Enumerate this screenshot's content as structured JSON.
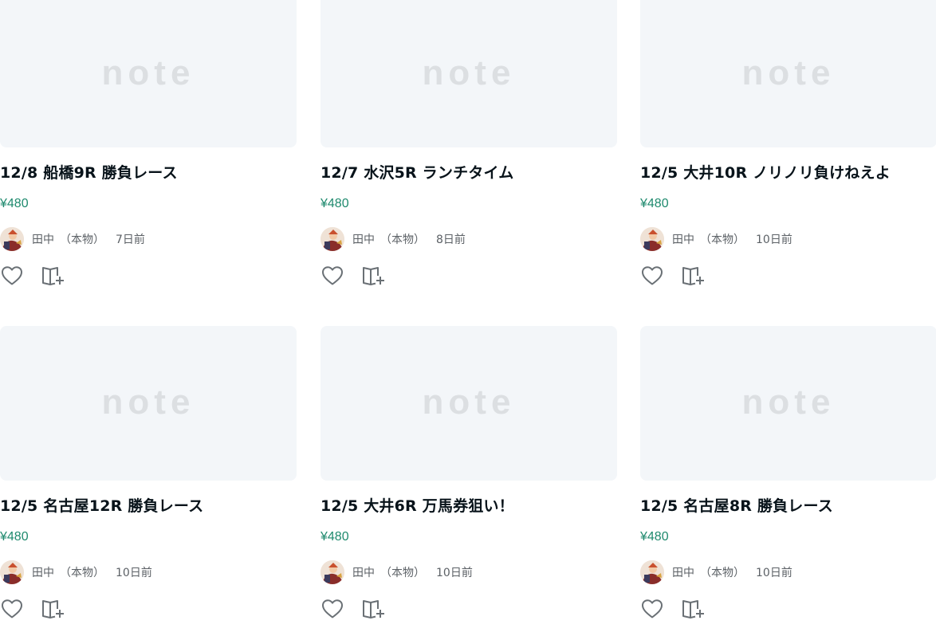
{
  "colors": {
    "thumbnail_bg": "#f3f6f9",
    "logo": "#dcdfe2",
    "price": "#1f8a6e",
    "title": "#08131a",
    "meta": "#5c6166",
    "icon": "#6a7075"
  },
  "icons": {
    "like": "heart-outline",
    "save": "magazine-add"
  },
  "cards": [
    {
      "logo": "note",
      "title": "12/8 船橋9R 勝負レース",
      "price": "¥480",
      "author": "田中　（本物）",
      "date": "7日前"
    },
    {
      "logo": "note",
      "title": "12/7 水沢5R ランチタイム",
      "price": "¥480",
      "author": "田中　（本物）",
      "date": "8日前"
    },
    {
      "logo": "note",
      "title": "12/5 大井10R ノリノリ負けねえよ",
      "price": "¥480",
      "author": "田中　（本物）",
      "date": "10日前"
    },
    {
      "logo": "note",
      "title": "12/5 名古屋12R 勝負レース",
      "price": "¥480",
      "author": "田中　（本物）",
      "date": "10日前"
    },
    {
      "logo": "note",
      "title": "12/5 大井6R 万馬券狙い！",
      "price": "¥480",
      "author": "田中　（本物）",
      "date": "10日前"
    },
    {
      "logo": "note",
      "title": "12/5 名古屋8R 勝負レース",
      "price": "¥480",
      "author": "田中　（本物）",
      "date": "10日前"
    }
  ]
}
